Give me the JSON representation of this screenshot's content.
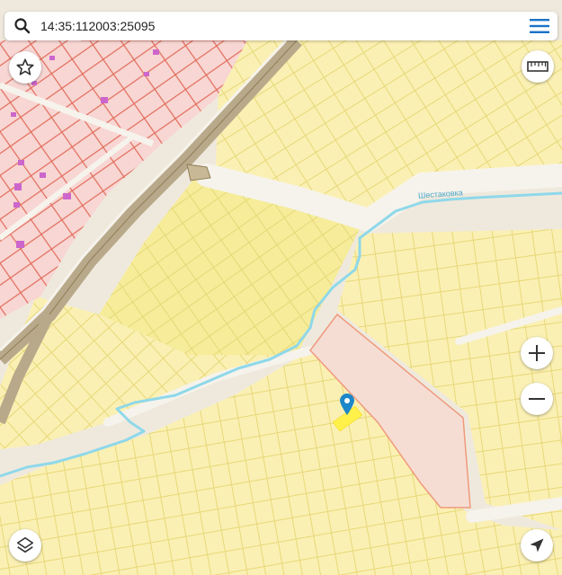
{
  "search": {
    "query": "14:35:112003:25095",
    "icon": "search-icon"
  },
  "menu": {
    "icon": "hamburger-menu-icon",
    "color": "#1a73c8"
  },
  "map": {
    "river_label": "Шестаковка",
    "colors": {
      "background": "#efe9dd",
      "road": "#f6f3ec",
      "parcel_fill": "#fbf0b3",
      "parcel_fill_bright": "#f6ec9a",
      "parcel_line": "#e6d878",
      "urban_fill": "#f8d6d3",
      "urban_line": "#e06b5a",
      "building": "#cc66cc",
      "river": "#8fd8ea",
      "highway_fill": "#b8a98a",
      "selected_parcel_fill": "#f5ddd4",
      "selected_parcel_line": "#ef9a7c",
      "marker": "#1c87c9",
      "highlight": "#fff04a"
    }
  },
  "controls": {
    "favorite": {
      "icon": "star-icon"
    },
    "ruler": {
      "icon": "ruler-icon"
    },
    "zoom_in": {
      "icon": "plus-icon"
    },
    "zoom_out": {
      "icon": "minus-icon"
    },
    "layers": {
      "icon": "layers-icon"
    },
    "locate": {
      "icon": "navigation-arrow-icon"
    }
  }
}
